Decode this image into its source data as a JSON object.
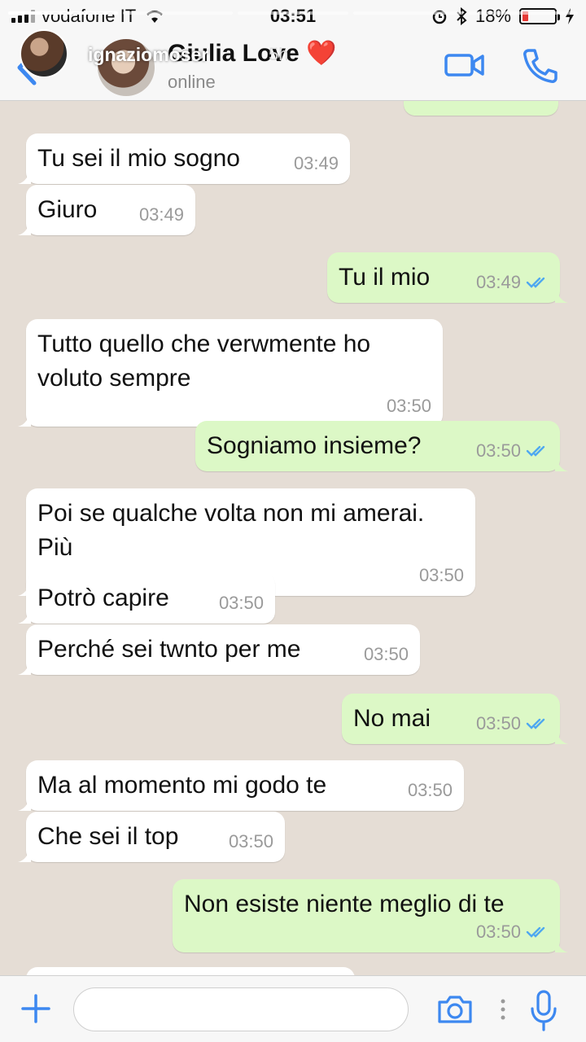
{
  "colors": {
    "accent": "#3d88f0",
    "bubble_in": "#ffffff",
    "bubble_out": "#dcf8c6",
    "chat_bg": "#e5ddd5",
    "tick_read": "#4fa8f0"
  },
  "status_bar": {
    "carrier": "vodafone IT",
    "time": "03:51",
    "battery": "18%",
    "battery_level": 0.18
  },
  "story_overlay": {
    "username": "ignaziomoser",
    "age": "5h"
  },
  "header": {
    "contact_name": "Giulia Love",
    "contact_emoji": "❤️",
    "status": "online"
  },
  "messages": [
    {
      "dir": "in",
      "text": "Tu sei il mio sogno",
      "time": "03:49"
    },
    {
      "dir": "in",
      "text": "Giuro",
      "time": "03:49"
    },
    {
      "dir": "out",
      "text": "Tu il mio",
      "time": "03:49"
    },
    {
      "dir": "in",
      "text": "Tutto quello che verwmente ho voluto sempre",
      "time": "03:50"
    },
    {
      "dir": "out",
      "text": "Sogniamo insieme?",
      "time": "03:50"
    },
    {
      "dir": "in",
      "text": "Poi se qualche volta non mi amerai. Più",
      "time": "03:50"
    },
    {
      "dir": "in",
      "text": "Potrò capire",
      "time": "03:50"
    },
    {
      "dir": "in",
      "text": "Perché sei twnto per me",
      "time": "03:50"
    },
    {
      "dir": "out",
      "text": "No mai",
      "time": "03:50"
    },
    {
      "dir": "in",
      "text": "Ma al momento mi godo te",
      "time": "03:50"
    },
    {
      "dir": "in",
      "text": "Che sei il top",
      "time": "03:50"
    },
    {
      "dir": "out",
      "text": "Non esiste niente meglio di te",
      "time": "03:50"
    }
  ],
  "input": {
    "placeholder": "",
    "value": ""
  },
  "icons": {
    "back": "chevron-left-icon",
    "video": "video-call-icon",
    "call": "phone-icon",
    "add": "plus-icon",
    "camera": "camera-icon",
    "mic": "microphone-icon"
  }
}
